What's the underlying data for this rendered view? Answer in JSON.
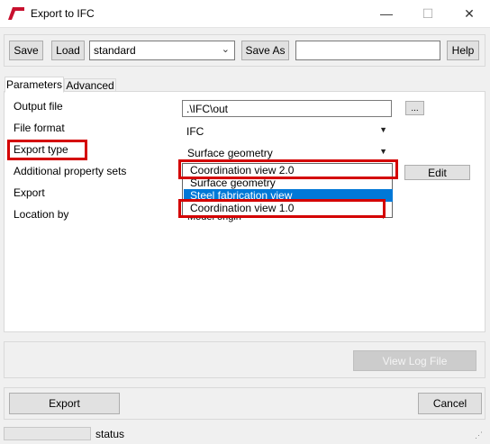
{
  "window": {
    "title": "Export to IFC",
    "minimize": "—",
    "maximize": "☐",
    "close": "✕"
  },
  "toolbar": {
    "save_label": "Save",
    "load_label": "Load",
    "preset_value": "standard",
    "save_as_label": "Save As",
    "save_as_value": "",
    "help_label": "Help"
  },
  "tabs": [
    {
      "label": "Parameters"
    },
    {
      "label": "Advanced"
    }
  ],
  "params": {
    "output_file_label": "Output file",
    "output_file_value": ".\\IFC\\out",
    "browse_label": "...",
    "file_format_label": "File format",
    "file_format_value": "IFC",
    "export_type_label": "Export type",
    "export_type_value": "Surface geometry",
    "additional_psets_label": "Additional property sets",
    "edit_label": "Edit",
    "export_label": "Export",
    "location_by_label": "Location by",
    "location_by_partial": "Model origin"
  },
  "dropdown": {
    "options": [
      {
        "label": "Coordination view 2.0",
        "selected": false
      },
      {
        "label": "Surface geometry",
        "selected": false
      },
      {
        "label": "Steel fabrication view",
        "selected": true
      },
      {
        "label": "Coordination view 1.0",
        "selected": false
      }
    ]
  },
  "log": {
    "view_log_label": "View Log File"
  },
  "footer": {
    "export_label": "Export",
    "cancel_label": "Cancel"
  },
  "status": {
    "text": "status"
  },
  "colors": {
    "highlight": "#d40000",
    "selection": "#0078d7"
  }
}
